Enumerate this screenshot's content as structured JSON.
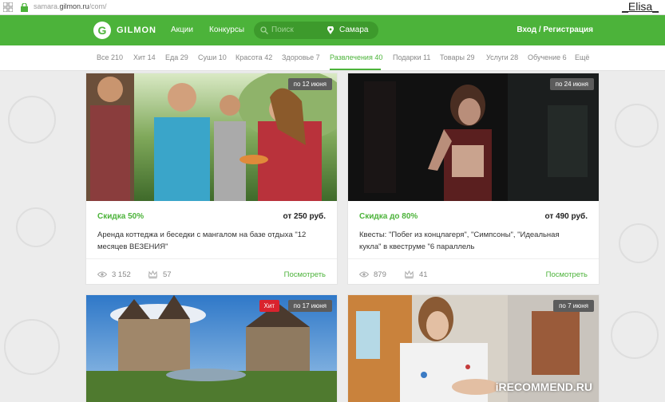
{
  "browser": {
    "url_prefix": "samara.",
    "url_domain": "gilmon.ru",
    "url_path": "/com/",
    "user_tag": "_Elisa_"
  },
  "header": {
    "brand": "GILMON",
    "logo_letter": "G",
    "nav": [
      "Акции",
      "Конкурсы"
    ],
    "search_placeholder": "Поиск",
    "city": "Самара",
    "login": "Вход / Регистрация"
  },
  "categories": [
    {
      "label": "Все 210"
    },
    {
      "label": "Хит 14"
    },
    {
      "label": "Еда 29"
    },
    {
      "label": "Суши 10"
    },
    {
      "label": "Красота 42"
    },
    {
      "label": "Здоровье 7"
    },
    {
      "label": "Развлечения 40",
      "active": true
    },
    {
      "label": "Подарки 11"
    },
    {
      "label": "Товары 29"
    },
    {
      "label": "Услуги 28"
    },
    {
      "label": "Обучение 6"
    },
    {
      "label": "Ещё"
    }
  ],
  "cards": [
    {
      "date": "по 12 июня",
      "discount": "Скидка 50%",
      "price": "от 250 руб.",
      "title": "Аренда коттеджа и беседки с мангалом на базе отдыха \"12 месяцев ВЕЗЕНИЯ\"",
      "views": "3 152",
      "likes": "57",
      "more": "Посмотреть"
    },
    {
      "date": "по 24 июня",
      "discount": "Скидка до 80%",
      "price": "от 490 руб.",
      "title": "Квесты: \"Побег из концлагеря\", \"Симпсоны\", \"Идеальная кукла\" в квеструме \"6 параллель",
      "views": "879",
      "likes": "41",
      "more": "Посмотреть"
    },
    {
      "badge": "Хит",
      "date": "по 17 июня"
    },
    {
      "date": "по 7 июня"
    }
  ],
  "watermark": "iRECOMMEND.RU",
  "colors": {
    "brand_green": "#4cb33a",
    "hit_red": "#d9232e",
    "date_badge": "#5c5c5c"
  }
}
